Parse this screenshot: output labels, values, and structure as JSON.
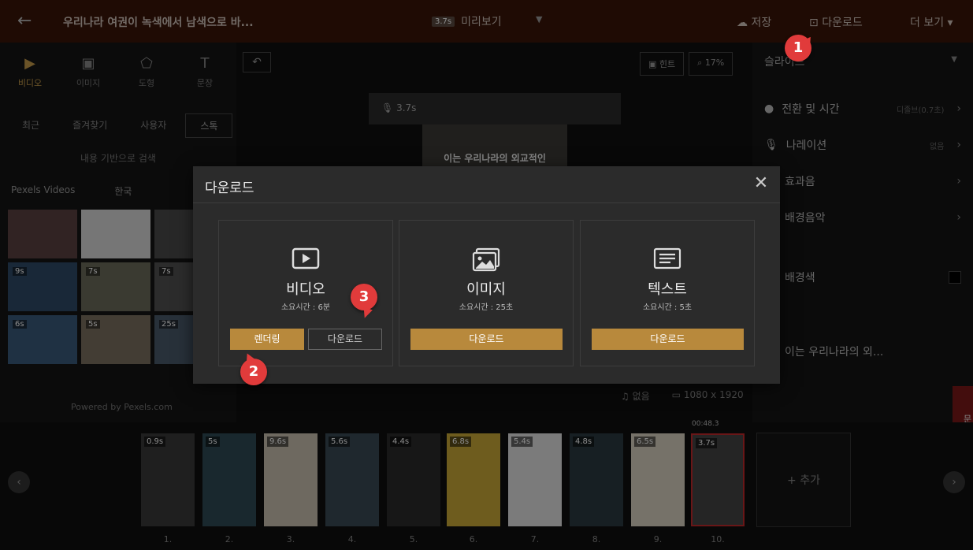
{
  "topbar": {
    "back": "←",
    "title": "우리나라 여권이 녹색에서 남색으로 바...",
    "preview_duration": "3.7s",
    "preview_label": "미리보기",
    "save_label": "저장",
    "download_label": "다운로드",
    "more_label": "더 보기 ▾"
  },
  "left_panel": {
    "tools": [
      {
        "label": "비디오",
        "icon": "video-icon"
      },
      {
        "label": "이미지",
        "icon": "image-icon"
      },
      {
        "label": "도형",
        "icon": "shape-icon"
      },
      {
        "label": "문장",
        "icon": "text-icon"
      }
    ],
    "subtabs": [
      "최근",
      "즐겨찾기",
      "사용자",
      "스톡"
    ],
    "search_hint": "내용 기반으로 검색",
    "source": "Pexels Videos",
    "region": "한국",
    "thumb_durations": [
      "",
      "",
      "",
      "9s",
      "7s",
      "7s",
      "6s",
      "5s",
      "25s"
    ],
    "powered": "Powered by Pexels.com"
  },
  "center": {
    "hint_label": "힌트",
    "zoom_label": "17%",
    "audio_duration": "3.7s",
    "canvas_badge": "3.7s",
    "canvas_caption": "이는 우리나라의 외교적인",
    "music_label": "없음",
    "resolution_label": "1080 x 1920"
  },
  "right_panel": {
    "title": "슬라이드",
    "transition_label": "전환 및 시간",
    "transition_sub": "디졸브(0.7초)",
    "narration_label": "나레이션",
    "narration_sub": "없음",
    "effect_label": "효과음",
    "bgm_label": "배경음악",
    "bg_color_label": "배경색",
    "caption_text": "이는 우리나라의 외...",
    "inquiry": "문의"
  },
  "timeline": {
    "clips": [
      {
        "dur": "0.9s",
        "num": "1."
      },
      {
        "dur": "5s",
        "num": "2."
      },
      {
        "dur": "9.6s",
        "num": "3."
      },
      {
        "dur": "5.6s",
        "num": "4."
      },
      {
        "dur": "4.4s",
        "num": "5."
      },
      {
        "dur": "6.8s",
        "num": "6."
      },
      {
        "dur": "5.4s",
        "num": "7."
      },
      {
        "dur": "4.8s",
        "num": "8."
      },
      {
        "dur": "6.5s",
        "num": "9."
      },
      {
        "dur": "3.7s",
        "num": "10."
      }
    ],
    "selected_time": "00:48.3",
    "add_label": "+ 추가"
  },
  "modal": {
    "title": "다운로드",
    "close": "✕",
    "cards": [
      {
        "name": "비디오",
        "time": "소요시간 : 6분",
        "primary": "렌더링",
        "secondary": "다운로드"
      },
      {
        "name": "이미지",
        "time": "소요시간 : 25초",
        "primary": "다운로드"
      },
      {
        "name": "텍스트",
        "time": "소요시간 : 5초",
        "primary": "다운로드"
      }
    ]
  },
  "markers": [
    "1",
    "2",
    "3"
  ],
  "colors": {
    "accent_gold": "#b8893c",
    "marker_red": "#e13b3b",
    "topbar_bg": "#3a1408"
  }
}
